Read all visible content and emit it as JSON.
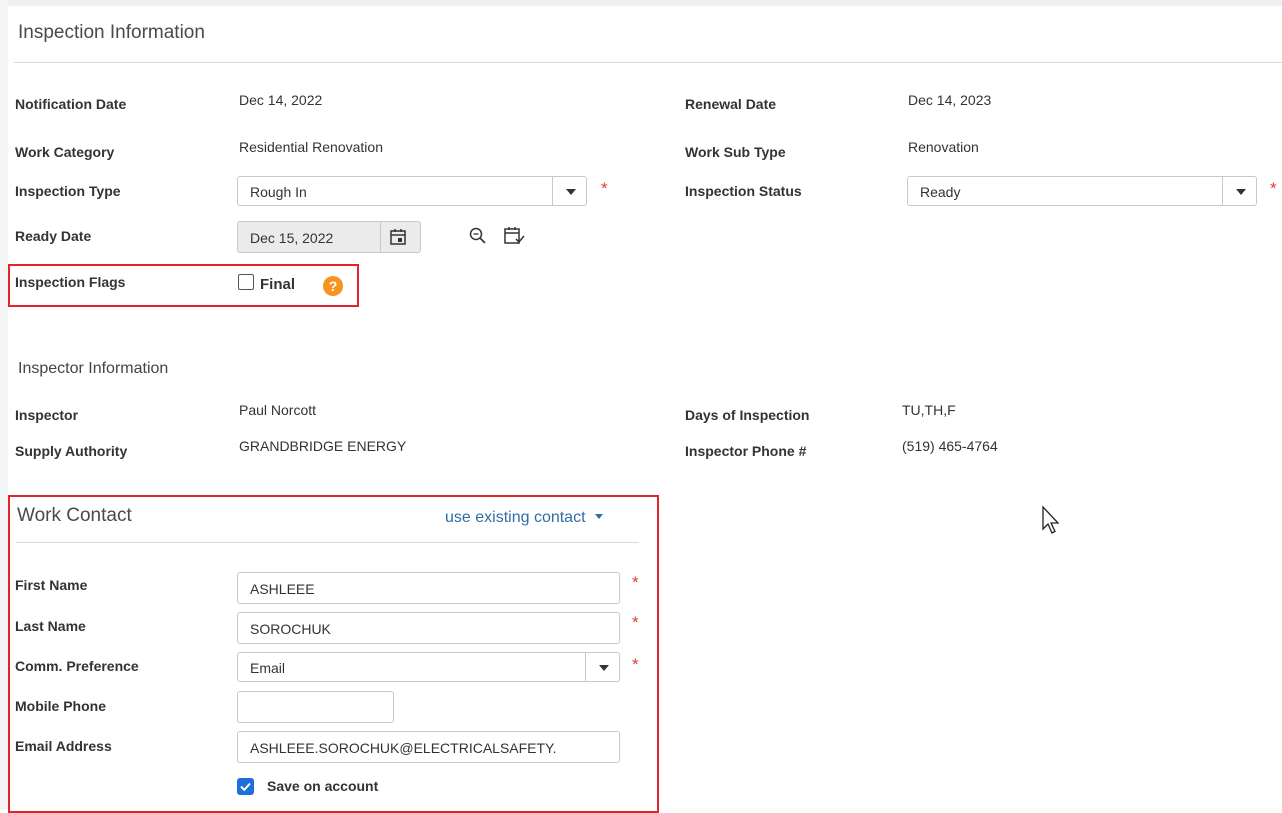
{
  "inspection": {
    "title": "Inspection Information",
    "notification_date_label": "Notification Date",
    "notification_date": "Dec 14, 2022",
    "renewal_date_label": "Renewal Date",
    "renewal_date": "Dec 14, 2023",
    "work_category_label": "Work Category",
    "work_category": "Residential Renovation",
    "work_sub_type_label": "Work Sub Type",
    "work_sub_type": "Renovation",
    "inspection_type_label": "Inspection Type",
    "inspection_type": "Rough In",
    "inspection_status_label": "Inspection Status",
    "inspection_status": "Ready",
    "ready_date_label": "Ready Date",
    "ready_date": "Dec 15, 2022",
    "flags_label": "Inspection Flags",
    "final_label": "Final",
    "final_checked": false,
    "help_glyph": "?",
    "required_mark": "*"
  },
  "inspector": {
    "title": "Inspector Information",
    "inspector_label": "Inspector",
    "inspector": "Paul Norcott",
    "supply_authority_label": "Supply Authority",
    "supply_authority": "GRANDBRIDGE ENERGY",
    "days_label": "Days of Inspection",
    "days": "TU,TH,F",
    "phone_label": "Inspector Phone #",
    "phone": "(519) 465-4764"
  },
  "work_contact": {
    "title": "Work Contact",
    "use_existing_link": "use existing contact",
    "first_name_label": "First Name",
    "first_name": "ASHLEEE",
    "last_name_label": "Last Name",
    "last_name": "SOROCHUK",
    "comm_pref_label": "Comm. Preference",
    "comm_pref": "Email",
    "mobile_label": "Mobile Phone",
    "mobile": "",
    "email_label": "Email Address",
    "email": "ASHLEEE.SOROCHUK@ELECTRICALSAFETY.",
    "save_label": "Save on account",
    "save_checked": true
  },
  "colors": {
    "accent": "#1e6fd9",
    "link": "#2f6ea8",
    "required": "#e0403a",
    "highlight_border": "#e2232a",
    "help": "#f7931e"
  },
  "icons": [
    "calendar-icon",
    "magnifier-icon",
    "calendar-check-icon",
    "help-icon",
    "mouse-pointer-icon",
    "chevron-down-icon"
  ]
}
